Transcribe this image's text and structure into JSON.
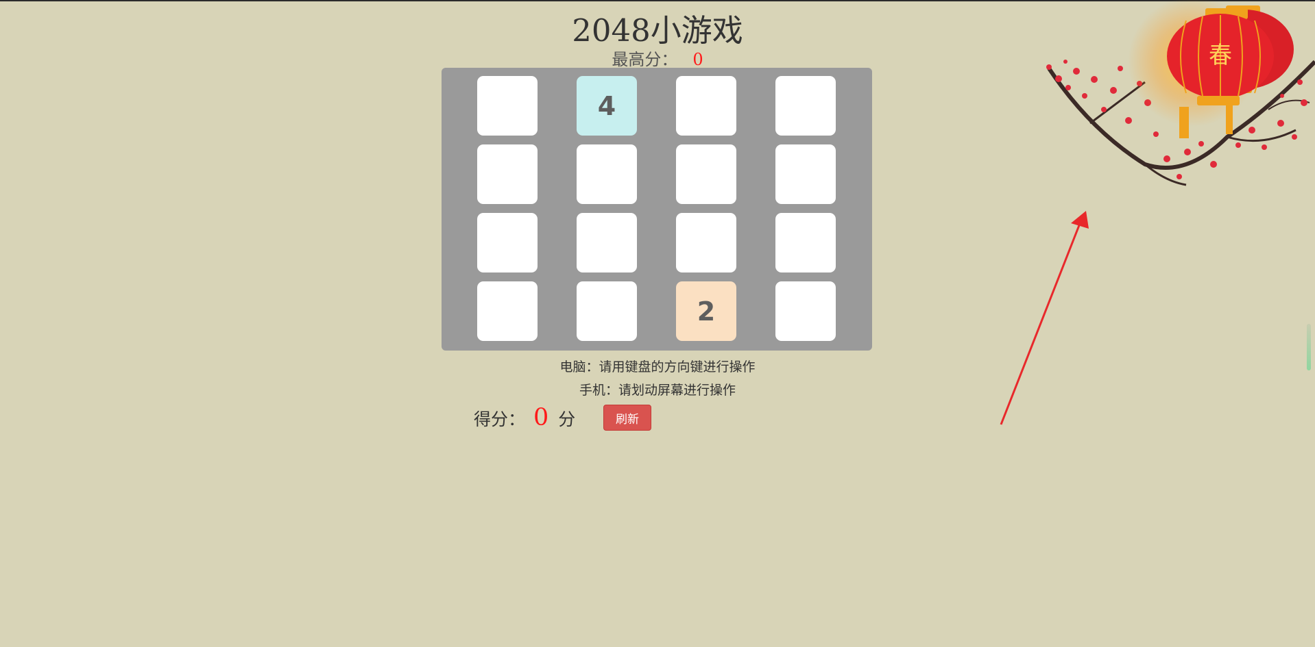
{
  "game": {
    "title": "2048小游戏",
    "best_label": "最高分：",
    "best_value": "0",
    "board": [
      [
        "",
        "4",
        "",
        ""
      ],
      [
        "",
        "",
        "",
        ""
      ],
      [
        "",
        "",
        "",
        ""
      ],
      [
        "",
        "",
        "2",
        ""
      ]
    ],
    "tile_colors": {
      "empty": "#ffffff",
      "2": "#fbe0c2",
      "4": "#c7efef"
    },
    "hint_pc": "电脑：请用键盘的方向键进行操作",
    "hint_mobile": "手机：请划动屏幕进行操作",
    "score_label": "得分：",
    "score_value": "0",
    "score_unit": "分",
    "refresh_label": "刷新"
  },
  "decoration": {
    "lantern_char": "春"
  }
}
